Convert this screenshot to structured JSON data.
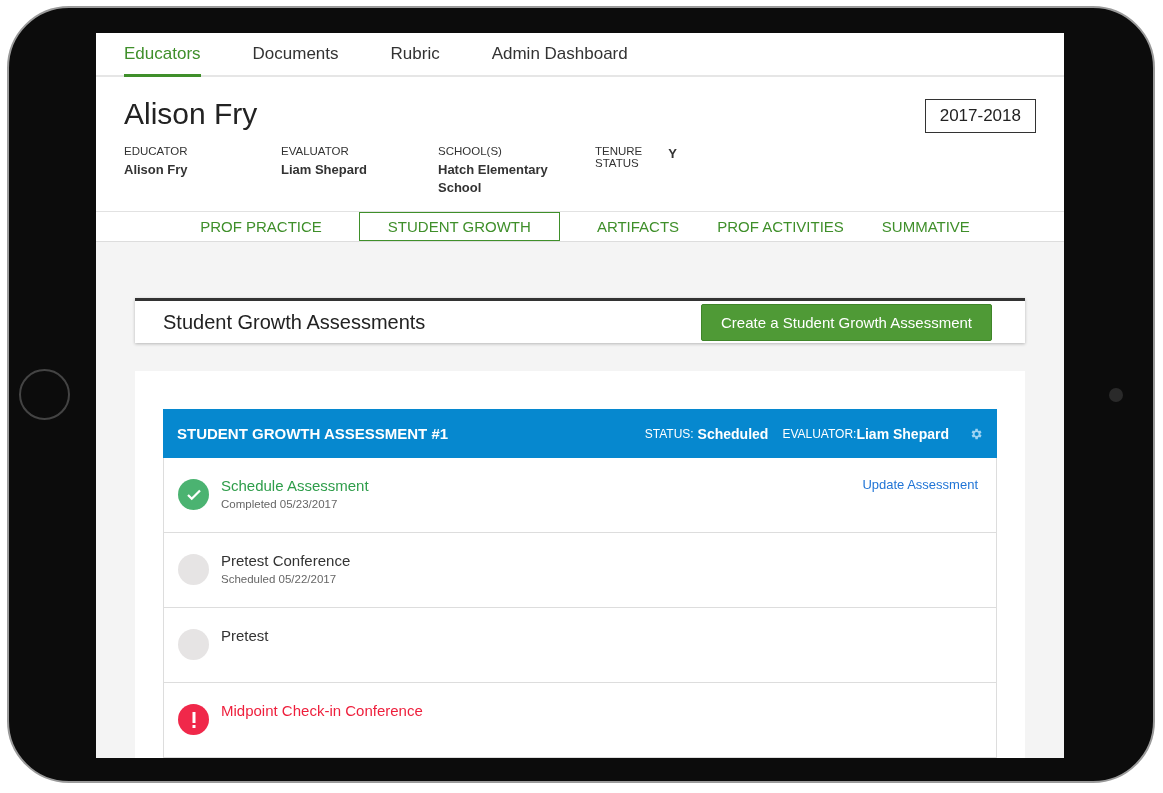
{
  "top_nav": [
    {
      "label": "Educators",
      "selected": true
    },
    {
      "label": "Documents",
      "selected": false
    },
    {
      "label": "Rubric",
      "selected": false
    },
    {
      "label": "Admin Dashboard",
      "selected": false
    }
  ],
  "educator": {
    "name": "Alison Fry",
    "year": "2017-2018",
    "fields": [
      {
        "label": "EDUCATOR",
        "value": "Alison Fry"
      },
      {
        "label": "EVALUATOR",
        "value": "Liam Shepard"
      },
      {
        "label": "SCHOOL(S)",
        "value": "Hatch Elementary School"
      },
      {
        "label": "TENURE STATUS",
        "value": "Y",
        "kind": "inline"
      }
    ]
  },
  "section_tabs": [
    {
      "label": "PROF PRACTICE",
      "selected": false
    },
    {
      "label": "STUDENT GROWTH",
      "selected": true
    },
    {
      "label": "ARTIFACTS",
      "selected": false
    },
    {
      "label": "PROF ACTIVITIES",
      "selected": false
    },
    {
      "label": "SUMMATIVE",
      "selected": false
    }
  ],
  "assessments_header": {
    "title": "Student Growth Assessments",
    "button": "Create a Student Growth Assessment"
  },
  "assessment": {
    "title": "STUDENT GROWTH ASSESSMENT #1",
    "status_label": "STATUS:",
    "status": "Scheduled",
    "evaluator_label": "EVALUATOR:",
    "evaluator": "Liam Shepard",
    "steps": [
      {
        "title": "Schedule Assessment",
        "subtitle": "Completed 05/23/2017",
        "kind": "done",
        "action": "Update Assessment"
      },
      {
        "title": "Pretest Conference",
        "subtitle": "Scheduled 05/22/2017",
        "kind": "pending"
      },
      {
        "title": "Pretest",
        "kind": "pending"
      },
      {
        "title": "Midpoint Check-in Conference",
        "kind": "alert"
      }
    ]
  }
}
